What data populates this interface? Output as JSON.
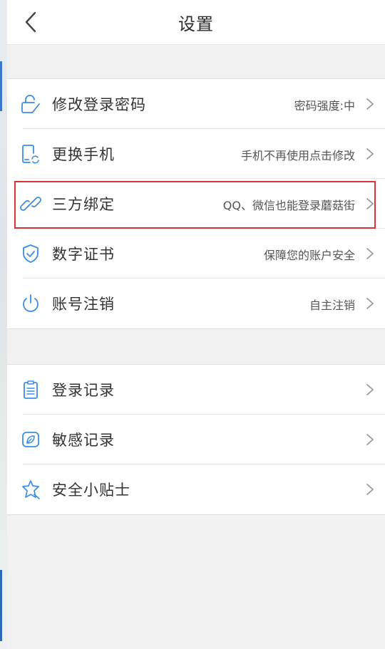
{
  "header": {
    "title": "设置",
    "back_icon": "chevron-left-icon"
  },
  "colors": {
    "icon_accent": "#3a8ee6",
    "highlight": "#d9343a",
    "background": "#f2f2f2"
  },
  "groups": [
    {
      "items": [
        {
          "label": "修改登录密码",
          "value": "密码强度:中",
          "icon": "lock-edit-icon"
        },
        {
          "label": "更换手机",
          "value": "手机不再使用点击修改",
          "icon": "phone-swap-icon"
        },
        {
          "label": "三方绑定",
          "value": "QQ、微信也能登录蘑菇街",
          "icon": "link-icon"
        },
        {
          "label": "数字证书",
          "value": "保障您的账户安全",
          "icon": "shield-check-icon"
        },
        {
          "label": "账号注销",
          "value": "自主注销",
          "icon": "power-icon"
        }
      ]
    },
    {
      "items": [
        {
          "label": "登录记录",
          "value": "",
          "icon": "clipboard-icon"
        },
        {
          "label": "敏感记录",
          "value": "",
          "icon": "leaf-icon"
        },
        {
          "label": "安全小贴士",
          "value": "",
          "icon": "star-badge-icon"
        }
      ]
    }
  ]
}
